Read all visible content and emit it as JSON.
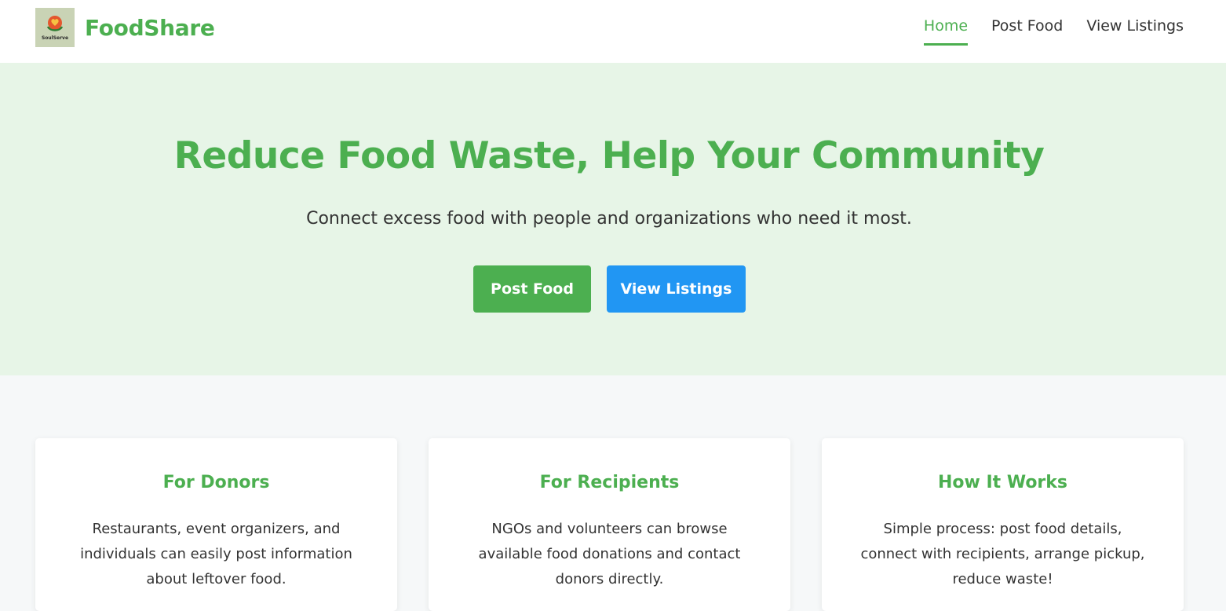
{
  "header": {
    "logo_text": "SoulServe",
    "brand": "FoodShare",
    "nav": [
      {
        "label": "Home",
        "active": true
      },
      {
        "label": "Post Food",
        "active": false
      },
      {
        "label": "View Listings",
        "active": false
      }
    ]
  },
  "hero": {
    "title": "Reduce Food Waste, Help Your Community",
    "subtitle": "Connect excess food with people and organizations who need it most.",
    "primary_button": "Post Food",
    "secondary_button": "View Listings"
  },
  "cards": [
    {
      "title": "For Donors",
      "text": "Restaurants, event organizers, and individuals can easily post information about leftover food."
    },
    {
      "title": "For Recipients",
      "text": "NGOs and volunteers can browse available food donations and contact donors directly."
    },
    {
      "title": "How It Works",
      "text": "Simple process: post food details, connect with recipients, arrange pickup, reduce waste!"
    }
  ],
  "colors": {
    "brand_green": "#4caf50",
    "accent_blue": "#2196f3",
    "hero_background": "#e7f5e7",
    "page_background": "#f6f8f9"
  }
}
